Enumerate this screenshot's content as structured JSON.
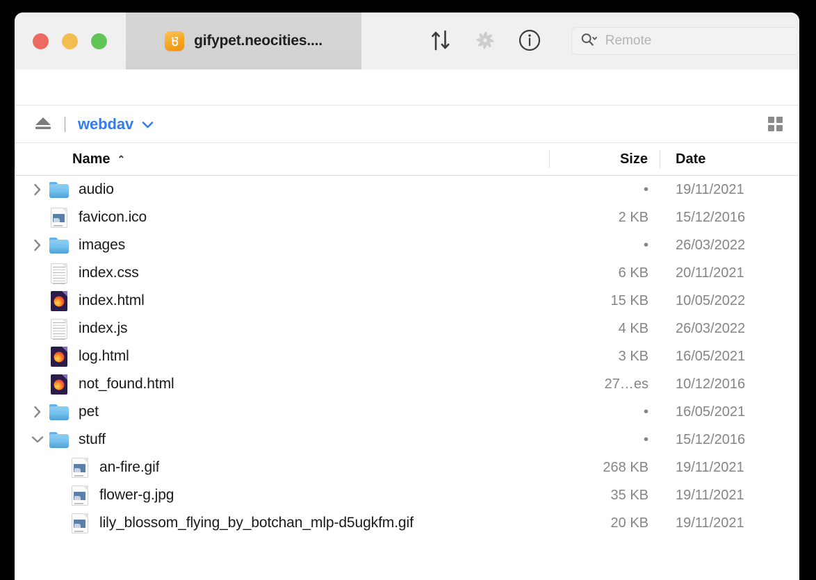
{
  "window": {
    "tab": {
      "title": "gifypet.neocities....",
      "icon": "cyberduck-app-icon"
    },
    "traffic_lights": [
      {
        "name": "close",
        "color": "#ec6a5f"
      },
      {
        "name": "minimize",
        "color": "#f3bd4f"
      },
      {
        "name": "maximize",
        "color": "#61c555"
      }
    ]
  },
  "toolbar": {
    "buttons": [
      {
        "name": "transfers",
        "icon": "transfer-arrows-icon"
      },
      {
        "name": "disconnect",
        "icon": "pinwheel-icon"
      },
      {
        "name": "get-info",
        "icon": "info-circle-icon"
      }
    ],
    "search": {
      "icon": "search-icon",
      "placeholder": "Remote",
      "value": ""
    }
  },
  "pathbar": {
    "eject_icon": "eject-icon",
    "crumb": "webdav",
    "crumb_chevron": "chevron-down-icon",
    "crumb_color": "#2f7cf6",
    "view_icon": "grid-view-icon"
  },
  "columns": {
    "name": "Name",
    "size": "Size",
    "date": "Date",
    "sort_column": "Name",
    "sort_caret": "⌃"
  },
  "files": [
    {
      "name": "audio",
      "size": "•",
      "date": "19/11/2021",
      "type": "folder",
      "depth": 0,
      "expanded": false,
      "disclosure": "chevron-right-icon"
    },
    {
      "name": "favicon.ico",
      "size": "2 KB",
      "date": "15/12/2016",
      "type": "image",
      "depth": 0,
      "expanded": null,
      "disclosure": ""
    },
    {
      "name": "images",
      "size": "•",
      "date": "26/03/2022",
      "type": "folder",
      "depth": 0,
      "expanded": false,
      "disclosure": "chevron-right-icon"
    },
    {
      "name": "index.css",
      "size": "6 KB",
      "date": "20/11/2021",
      "type": "text",
      "depth": 0,
      "expanded": null,
      "disclosure": ""
    },
    {
      "name": "index.html",
      "size": "15 KB",
      "date": "10/05/2022",
      "type": "html",
      "depth": 0,
      "expanded": null,
      "disclosure": ""
    },
    {
      "name": "index.js",
      "size": "4 KB",
      "date": "26/03/2022",
      "type": "text",
      "depth": 0,
      "expanded": null,
      "disclosure": ""
    },
    {
      "name": "log.html",
      "size": "3 KB",
      "date": "16/05/2021",
      "type": "html",
      "depth": 0,
      "expanded": null,
      "disclosure": ""
    },
    {
      "name": "not_found.html",
      "size": "27…es",
      "date": "10/12/2016",
      "type": "html",
      "depth": 0,
      "expanded": null,
      "disclosure": ""
    },
    {
      "name": "pet",
      "size": "•",
      "date": "16/05/2021",
      "type": "folder",
      "depth": 0,
      "expanded": false,
      "disclosure": "chevron-right-icon"
    },
    {
      "name": "stuff",
      "size": "•",
      "date": "15/12/2016",
      "type": "folder",
      "depth": 0,
      "expanded": true,
      "disclosure": "chevron-down-icon"
    },
    {
      "name": "an-fire.gif",
      "size": "268 KB",
      "date": "19/11/2021",
      "type": "image",
      "depth": 1,
      "expanded": null,
      "disclosure": ""
    },
    {
      "name": "flower-g.jpg",
      "size": "35 KB",
      "date": "19/11/2021",
      "type": "image",
      "depth": 1,
      "expanded": null,
      "disclosure": ""
    },
    {
      "name": "lily_blossom_flying_by_botchan_mlp-d5ugkfm.gif",
      "size": "20 KB",
      "date": "19/11/2021",
      "type": "image",
      "depth": 1,
      "expanded": null,
      "disclosure": ""
    }
  ]
}
